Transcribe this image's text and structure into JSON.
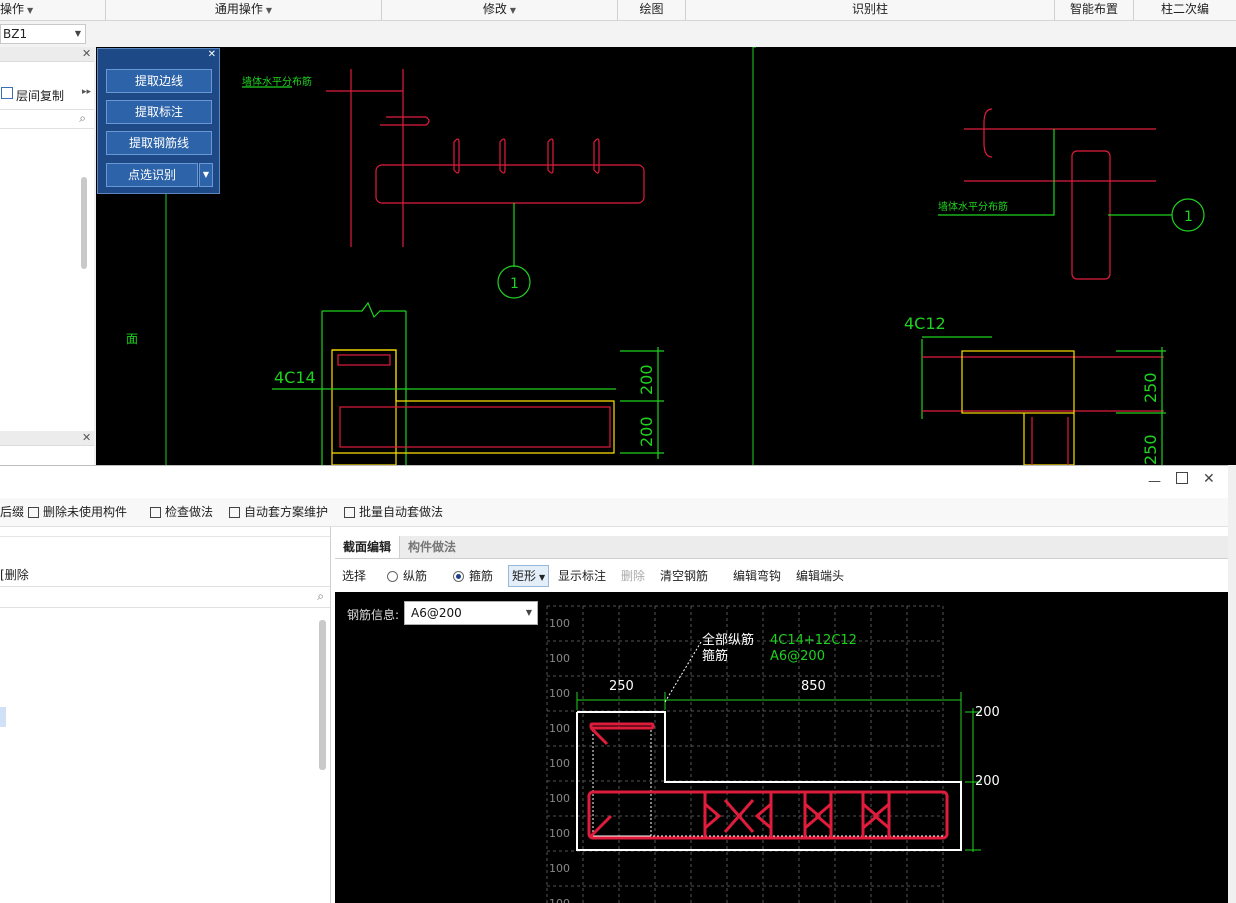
{
  "ribbon": {
    "groups": [
      {
        "label": "操作",
        "dropdown": true
      },
      {
        "label": "通用操作",
        "dropdown": true
      },
      {
        "label": "修改",
        "dropdown": true
      },
      {
        "label": "绘图",
        "dropdown": false
      },
      {
        "label": "识别柱",
        "dropdown": false
      },
      {
        "label": "智能布置",
        "dropdown": false
      },
      {
        "label": "柱二次编",
        "dropdown": false
      }
    ]
  },
  "component_select": {
    "value": "BZ1"
  },
  "left_panel": {
    "floor_copy_label": "层间复制"
  },
  "extract_panel": {
    "buttons": [
      "提取边线",
      "提取标注",
      "提取钢筋线",
      "点选识别"
    ]
  },
  "cad": {
    "labels": {
      "note_left": "墙体水平分布筋",
      "note_right": "墙体水平分布筋",
      "rebar_left": "4C14",
      "rebar_right": "4C12",
      "marker": "1",
      "dim_200a": "200",
      "dim_200b": "200",
      "dim_250a": "250",
      "dim_250b": "250",
      "vertical_text": "面"
    }
  },
  "dialog": {
    "toolbar": [
      "后缀",
      "删除未使用构件",
      "检查做法",
      "自动套方案维护",
      "批量自动套做法"
    ],
    "left_delete_label": "删除",
    "tabs": [
      "截面编辑",
      "构件做法"
    ],
    "edit_tools": {
      "select": "选择",
      "longitudinal": "纵筋",
      "stirrup": "箍筋",
      "shape": "矩形",
      "show_label": "显示标注",
      "delete": "删除",
      "clear": "清空钢筋",
      "edit_hook": "编辑弯钩",
      "edit_end": "编辑端头"
    },
    "rebar_info_label": "钢筋信息:",
    "rebar_info_value": "A6@200"
  },
  "section": {
    "all_long_label": "全部纵筋",
    "all_long_value": "4C14+12C12",
    "stirrup_label": "箍筋",
    "stirrup_value": "A6@200",
    "dim_top_left": "250",
    "dim_top_right": "850",
    "dim_right_top": "200",
    "dim_right_bottom": "200",
    "grid_label": "100",
    "colors": {
      "rebar": "#e01c3c",
      "dimension": "#1fd21f",
      "outline": "#ffffff"
    }
  }
}
